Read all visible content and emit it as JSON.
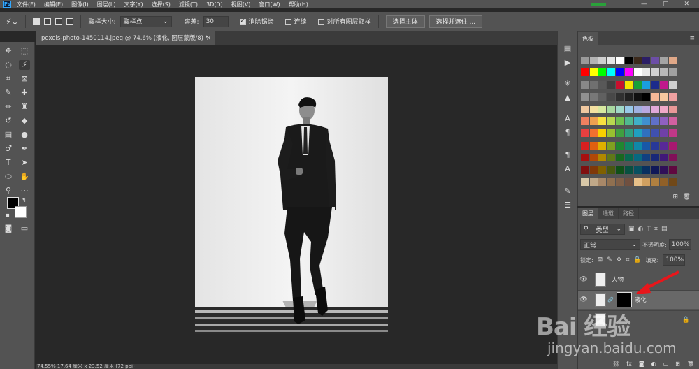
{
  "menu": {
    "logo": "Ps",
    "items": [
      "文件(F)",
      "编辑(E)",
      "图像(I)",
      "图层(L)",
      "文字(Y)",
      "选择(S)",
      "滤镜(T)",
      "3D(D)",
      "视图(V)",
      "窗口(W)",
      "帮助(H)"
    ],
    "min": "—",
    "max": "▢",
    "close": "✕"
  },
  "options": {
    "sample_size_label": "取样大小:",
    "sample_size_value": "取样点",
    "tolerance_label": "容差:",
    "tolerance_value": "30",
    "antialias_label": "消除锯齿",
    "contiguous_label": "连续",
    "all_layers_label": "对所有图层取样",
    "select_subject": "选择主体",
    "select_mask": "选择并遮住 ..."
  },
  "document": {
    "tab_title": "pexels-photo-1450114.jpeg @ 74.6% (液化, 图层蒙版/8) *",
    "close": "×",
    "status": "74.55%     17.64 厘米 x 23.52 厘米 (72 ppi)"
  },
  "swatches": {
    "tab": "色板",
    "colors": [
      "#9a9a9a",
      "#b4b4b4",
      "#cfcfcf",
      "#e6e6e6",
      "#ffffff",
      "#000000",
      "#3c2a1c",
      "#2b1e66",
      "#6c4ea6",
      "#a4a4a4",
      "#e0a888",
      "#ff0000",
      "#ffff00",
      "#00ff00",
      "#00ffff",
      "#0000ff",
      "#ff00ff",
      "#ffffff",
      "#e8e8e8",
      "#d0d0d0",
      "#b8b8b8",
      "#a0a0a0",
      "#888888",
      "#707070",
      "#585858",
      "#404040",
      "#c8102e",
      "#f5e400",
      "#18a038",
      "#1a9ee0",
      "#1c2b8c",
      "#c0188c",
      "#d0d0d0",
      "#909090",
      "#787878",
      "#606060",
      "#484848",
      "#303030",
      "#202020",
      "#101010",
      "#000000",
      "#f4b898",
      "#f8c8a0",
      "#f0a0a0",
      "#f0c8a0",
      "#f4e0a0",
      "#d8e8a0",
      "#a8d8a0",
      "#a0d8c8",
      "#98c8e8",
      "#a0b0e0",
      "#b8a8e0",
      "#e0a8d8",
      "#f0a8c8",
      "#e89898",
      "#f08060",
      "#f0a050",
      "#f8e040",
      "#b8d850",
      "#70c050",
      "#50b890",
      "#40b0c8",
      "#4090d0",
      "#6070c8",
      "#9060c0",
      "#d060a0",
      "#e84040",
      "#f07030",
      "#f8d000",
      "#98c030",
      "#40a040",
      "#30a080",
      "#20a0c0",
      "#3070c0",
      "#4050b0",
      "#7040a8",
      "#c03888",
      "#d82020",
      "#e06010",
      "#e0b000",
      "#80a020",
      "#208830",
      "#108868",
      "#1088a8",
      "#1858a8",
      "#283898",
      "#582898",
      "#a81870",
      "#a81010",
      "#b04808",
      "#b08800",
      "#607818",
      "#186820",
      "#086850",
      "#086880",
      "#104080",
      "#182878",
      "#401878",
      "#801058",
      "#801010",
      "#803808",
      "#806000",
      "#485810",
      "#105018",
      "#085040",
      "#085060",
      "#083060",
      "#101858",
      "#301058",
      "#600840",
      "#d8c8a8",
      "#c0a888",
      "#a88868",
      "#907050",
      "#806048",
      "#705040",
      "#e8c088",
      "#d0a060",
      "#b08040",
      "#906028",
      "#704818"
    ]
  },
  "layers": {
    "tabs": [
      "图层",
      "通道",
      "路径"
    ],
    "filter_kind": "类型",
    "blend_mode": "正常",
    "opacity_label": "不透明度:",
    "opacity_value": "100%",
    "lock_label": "锁定:",
    "fill_label": "填充:",
    "fill_value": "100%",
    "items": [
      {
        "name": "人物"
      },
      {
        "name": "液化"
      }
    ]
  },
  "watermark": {
    "line1": "Bai 经验",
    "line2": "jingyan.baidu.com"
  }
}
